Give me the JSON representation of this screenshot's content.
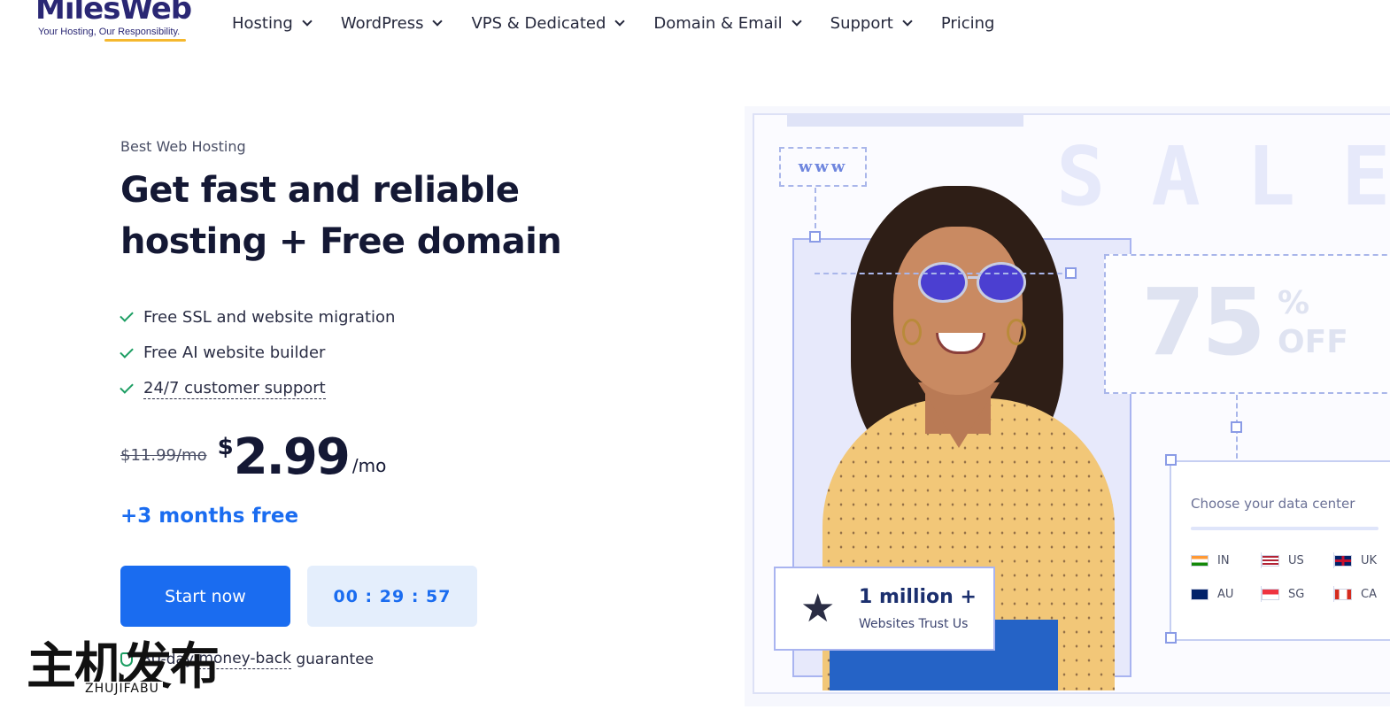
{
  "header": {
    "logo_text": "MilesWeb",
    "logo_tagline": "Your Hosting, Our Responsibility.",
    "nav": [
      {
        "label": "Hosting",
        "has_dropdown": true
      },
      {
        "label": "WordPress",
        "has_dropdown": true
      },
      {
        "label": "VPS & Dedicated",
        "has_dropdown": true
      },
      {
        "label": "Domain & Email",
        "has_dropdown": true
      },
      {
        "label": "Support",
        "has_dropdown": true
      },
      {
        "label": "Pricing",
        "has_dropdown": false
      }
    ]
  },
  "hero": {
    "eyebrow": "Best Web Hosting",
    "headline_line1": "Get fast and reliable",
    "headline_line2": "hosting + Free domain",
    "features": [
      "Free SSL and website migration",
      "Free AI website builder",
      "24/7 customer support"
    ],
    "old_price": "$11.99/mo",
    "currency": "$",
    "price": "2.99",
    "per": "/mo",
    "bonus": "+3 months free",
    "cta_label": "Start now",
    "countdown": "00 : 29 : 57",
    "guarantee_prefix": "30-day",
    "guarantee_link": "money-back",
    "guarantee_suffix": "guarantee",
    "check_color": "#1d9e63",
    "accent_color": "#1a6cf0"
  },
  "banner": {
    "www_text": "www",
    "sale_text": "SALE",
    "discount_number": "75",
    "discount_percent": "%",
    "discount_word": "OFF",
    "data_center_title": "Choose your data center",
    "data_centers": [
      {
        "code": "IN"
      },
      {
        "code": "US"
      },
      {
        "code": "UK"
      },
      {
        "code": "AU"
      },
      {
        "code": "SG"
      },
      {
        "code": "CA"
      }
    ],
    "trust_count": "1 million +",
    "trust_label": "Websites Trust Us",
    "trust_icon": "trophy-star-icon"
  },
  "watermark": {
    "cn": "主机发布",
    "en": "ZHUJIFABU"
  }
}
